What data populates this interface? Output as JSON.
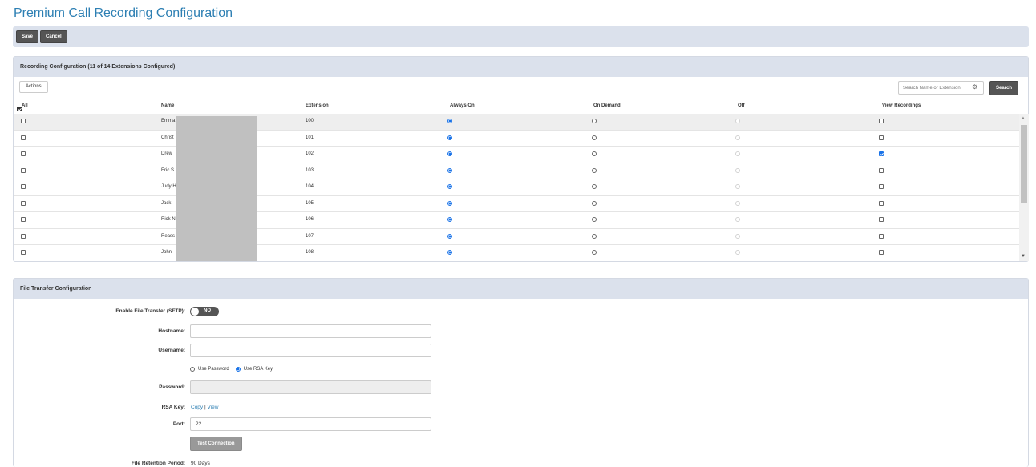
{
  "page": {
    "title": "Premium Call Recording Configuration"
  },
  "toolbar": {
    "save_label": "Save",
    "cancel_label": "Cancel"
  },
  "recording": {
    "panel_title": "Recording Configuration (11 of 14 Extensions Configured)",
    "actions_label": "Actions",
    "search_placeholder": "Search Name or Extension",
    "search_label": "Search",
    "columns": {
      "all": "All",
      "name": "Name",
      "extension": "Extension",
      "always_on": "Always On",
      "on_demand": "On Demand",
      "off": "Off",
      "view_recordings": "View Recordings"
    },
    "rows": [
      {
        "name": "Emma",
        "extension": "100",
        "mode": "always_on",
        "view": false
      },
      {
        "name": "Christ",
        "extension": "101",
        "mode": "always_on",
        "view": false
      },
      {
        "name": "Drew",
        "extension": "102",
        "mode": "always_on",
        "view": true
      },
      {
        "name": "Eric S",
        "extension": "103",
        "mode": "always_on",
        "view": false
      },
      {
        "name": "Judy H",
        "extension": "104",
        "mode": "always_on",
        "view": false
      },
      {
        "name": "Jack",
        "extension": "105",
        "mode": "always_on",
        "view": false
      },
      {
        "name": "Rick N",
        "extension": "106",
        "mode": "always_on",
        "view": false
      },
      {
        "name": "Reass",
        "extension": "107",
        "mode": "always_on",
        "view": false
      },
      {
        "name": "John",
        "extension": "108",
        "mode": "always_on",
        "view": false
      }
    ]
  },
  "file_transfer": {
    "panel_title": "File Transfer Configuration",
    "enable_label": "Enable File Transfer (SFTP):",
    "enable_state": "NO",
    "hostname_label": "Hostname:",
    "hostname_value": "",
    "username_label": "Username:",
    "username_value": "",
    "use_password_label": "Use Password",
    "use_rsa_label": "Use RSA Key",
    "password_label": "Password:",
    "rsa_key_label": "RSA Key:",
    "copy_label": "Copy",
    "link_separator": "|",
    "view_label": "View",
    "port_label": "Port:",
    "port_value": "22",
    "test_label": "Test Connection",
    "retention_label": "File Retention Period:",
    "retention_value": "90 Days"
  },
  "colors": {
    "title": "#2d7fb3",
    "header_bg": "#dbe1ec",
    "button_dark": "#555555",
    "radio_selected": "#1a73e8"
  },
  "icons": {
    "gear": "gear-icon",
    "check_all": "checkbox-icon"
  }
}
